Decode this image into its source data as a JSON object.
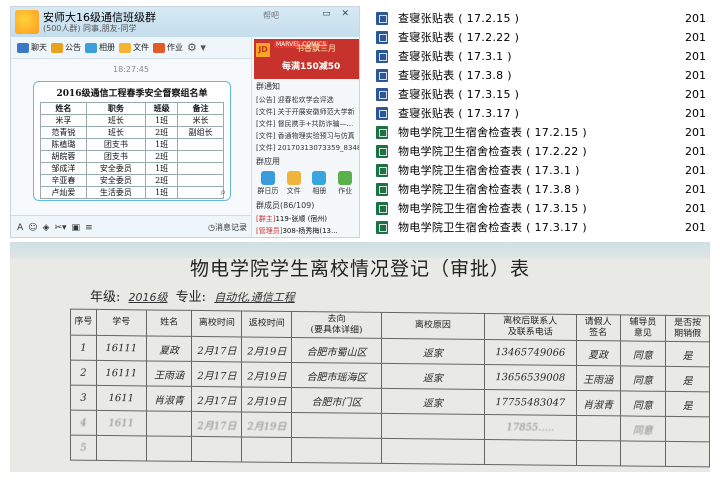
{
  "qq": {
    "title": "安师大16级通信班级群",
    "subtitle": "(500人群) 同事,朋友-同学",
    "help": "帮吧",
    "toolbar": [
      {
        "label": "聊天",
        "color": "#3a78c6"
      },
      {
        "label": "公告",
        "color": "#e8a21c"
      },
      {
        "label": "相册",
        "color": "#3aa0d8"
      },
      {
        "label": "文件",
        "color": "#f3b431"
      },
      {
        "label": "作业",
        "color": "#e25a2a"
      }
    ],
    "chat_time": "18:27:45",
    "input_bar": {
      "history_label": "消息记录"
    },
    "roster": {
      "title": "2016级通信工程春季安全督察组名单",
      "headers": [
        "姓名",
        "职务",
        "班级",
        "备注"
      ],
      "rows": [
        [
          "米孚",
          "班长",
          "1班",
          "米长"
        ],
        [
          "范青锐",
          "班长",
          "2班",
          "副组长"
        ],
        [
          "陈植璐",
          "团支书",
          "1班",
          ""
        ],
        [
          "胡皖蓉",
          "团支书",
          "2班",
          ""
        ],
        [
          "邹成洋",
          "安全委员",
          "1班",
          ""
        ],
        [
          "辛亚春",
          "安全委员",
          "2班",
          ""
        ],
        [
          "卢灿爱",
          "生活委员",
          "1班",
          ""
        ]
      ]
    },
    "ad": {
      "logo": "JD",
      "brand": "MARVEL COMICS",
      "line1": "书香飘三月",
      "line2": "每满150减50"
    },
    "side_header": "群通知",
    "notices": [
      "[公告] 迎春松欢学会评选",
      "[文件] 关于开展安徽师范大学新",
      "[文件] 督民携手+共防诈骗—...",
      "[文件] 香通物理实验预习与仿真",
      "[文件] 20170313073359_83489.d"
    ],
    "app_header": "群应用",
    "apps": [
      {
        "label": "群日历",
        "color": "#3a9bd9"
      },
      {
        "label": "文件",
        "color": "#f1b43a"
      },
      {
        "label": "相册",
        "color": "#39a5dc"
      },
      {
        "label": "作业",
        "color": "#5bb04e"
      }
    ],
    "members_header": "群成员(86/109)",
    "members": [
      {
        "tag": "[群主]",
        "name": "119-张顺 (宿州)"
      },
      {
        "tag": "[管理员]",
        "name": "308-杨秀梅(13..."
      }
    ]
  },
  "files": [
    {
      "name": "查寝张贴表 ( 17.2.15 )",
      "date": "201",
      "type": "doc"
    },
    {
      "name": "查寝张贴表 ( 17.2.22 )",
      "date": "201",
      "type": "doc"
    },
    {
      "name": "查寝张贴表 ( 17.3.1 )",
      "date": "201",
      "type": "doc"
    },
    {
      "name": "查寝张贴表 ( 17.3.8 )",
      "date": "201",
      "type": "doc"
    },
    {
      "name": "查寝张贴表 ( 17.3.15 )",
      "date": "201",
      "type": "doc"
    },
    {
      "name": "查寝张贴表 ( 17.3.17 )",
      "date": "201",
      "type": "doc"
    },
    {
      "name": "物电学院卫生宿舍检查表 ( 17.2.15 )",
      "date": "201",
      "type": "xls"
    },
    {
      "name": "物电学院卫生宿舍检查表 ( 17.2.22 )",
      "date": "201",
      "type": "xls"
    },
    {
      "name": "物电学院卫生宿舍检查表 ( 17.3.1 )",
      "date": "201",
      "type": "xls"
    },
    {
      "name": "物电学院卫生宿舍检查表 ( 17.3.8 )",
      "date": "201",
      "type": "xls"
    },
    {
      "name": "物电学院卫生宿舍检查表 ( 17.3.15 )",
      "date": "201",
      "type": "xls"
    },
    {
      "name": "物电学院卫生宿舍检查表 ( 17.3.17 )",
      "date": "201",
      "type": "xls"
    }
  ],
  "paper": {
    "title": "物电学院学生离校情况登记（审批）表",
    "grade_label": "年级:",
    "grade_value": "2016级",
    "major_label": "专业:",
    "major_value": "自动化,通信工程",
    "headers": [
      "序号",
      "学号",
      "姓名",
      "离校时间",
      "返校时间",
      "去向\n(要具体详细)",
      "离校原因",
      "离校后联系人\n及联系电话",
      "请假人\n签名",
      "辅导员\n意见",
      "是否按\n期销假"
    ],
    "rows": [
      [
        "1",
        "16111",
        "夏政",
        "2月17日",
        "2月19日",
        "合肥市蜀山区",
        "返家",
        "13465749066",
        "夏政",
        "同意",
        "是"
      ],
      [
        "2",
        "16111",
        "王雨涵",
        "2月17日",
        "2月19日",
        "合肥市瑶海区",
        "返家",
        "13656539008",
        "王雨涵",
        "同意",
        "是"
      ],
      [
        "3",
        "1611",
        "肖淑青",
        "2月17日",
        "2月19日",
        "合肥市门区",
        "返家",
        "17755483047",
        "肖淑青",
        "同意",
        "是"
      ],
      [
        "4",
        "1611",
        "",
        "2月17日",
        "2月19日",
        "",
        "",
        "17855.....",
        "",
        "同意",
        ""
      ],
      [
        "5",
        "",
        "",
        "",
        "",
        "",
        "",
        "",
        "",
        "",
        ""
      ]
    ]
  }
}
